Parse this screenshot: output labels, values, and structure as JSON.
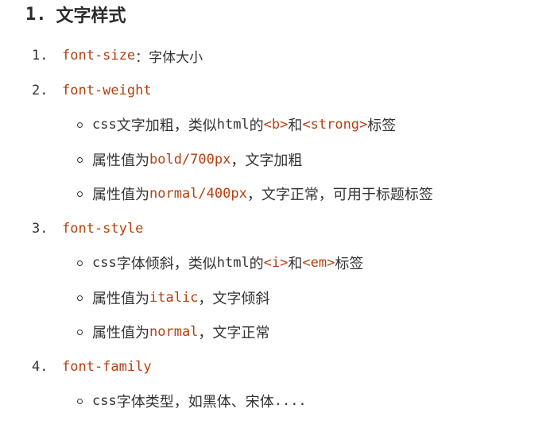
{
  "heading": {
    "number": "1.",
    "title": "文字样式"
  },
  "items": [
    {
      "number": "1.",
      "code": "font-size",
      "suffix": "：字体大小"
    },
    {
      "number": "2.",
      "code": "font-weight",
      "subs": [
        {
          "a": "css",
          "b": "文字加粗，类似",
          "c": "html",
          "d": "的",
          "code1": "<b>",
          "e": "和",
          "code2": "<strong>",
          "f": "标签"
        },
        {
          "a": "属性值为",
          "code": "bold/700px",
          "b": "，文字加粗"
        },
        {
          "a": "属性值为",
          "code": "normal/400px",
          "b": "，文字正常，可用于标题标签"
        }
      ]
    },
    {
      "number": "3.",
      "code": "font-style",
      "subs": [
        {
          "a": "css",
          "b": "字体倾斜，类似",
          "c": "html",
          "d": "的",
          "code1": "<i>",
          "e": "和",
          "code2": "<em>",
          "f": "标签"
        },
        {
          "a": "属性值为",
          "code": "italic",
          "b": "，文字倾斜"
        },
        {
          "a": "属性值为",
          "code": "normal",
          "b": "，文字正常"
        }
      ]
    },
    {
      "number": "4.",
      "code": "font-family",
      "subs": [
        {
          "a": "css",
          "b": "字体类型，如黑体、宋体",
          "c": "...."
        }
      ]
    }
  ],
  "colors": {
    "code": "#b5400f",
    "text": "#333333"
  }
}
